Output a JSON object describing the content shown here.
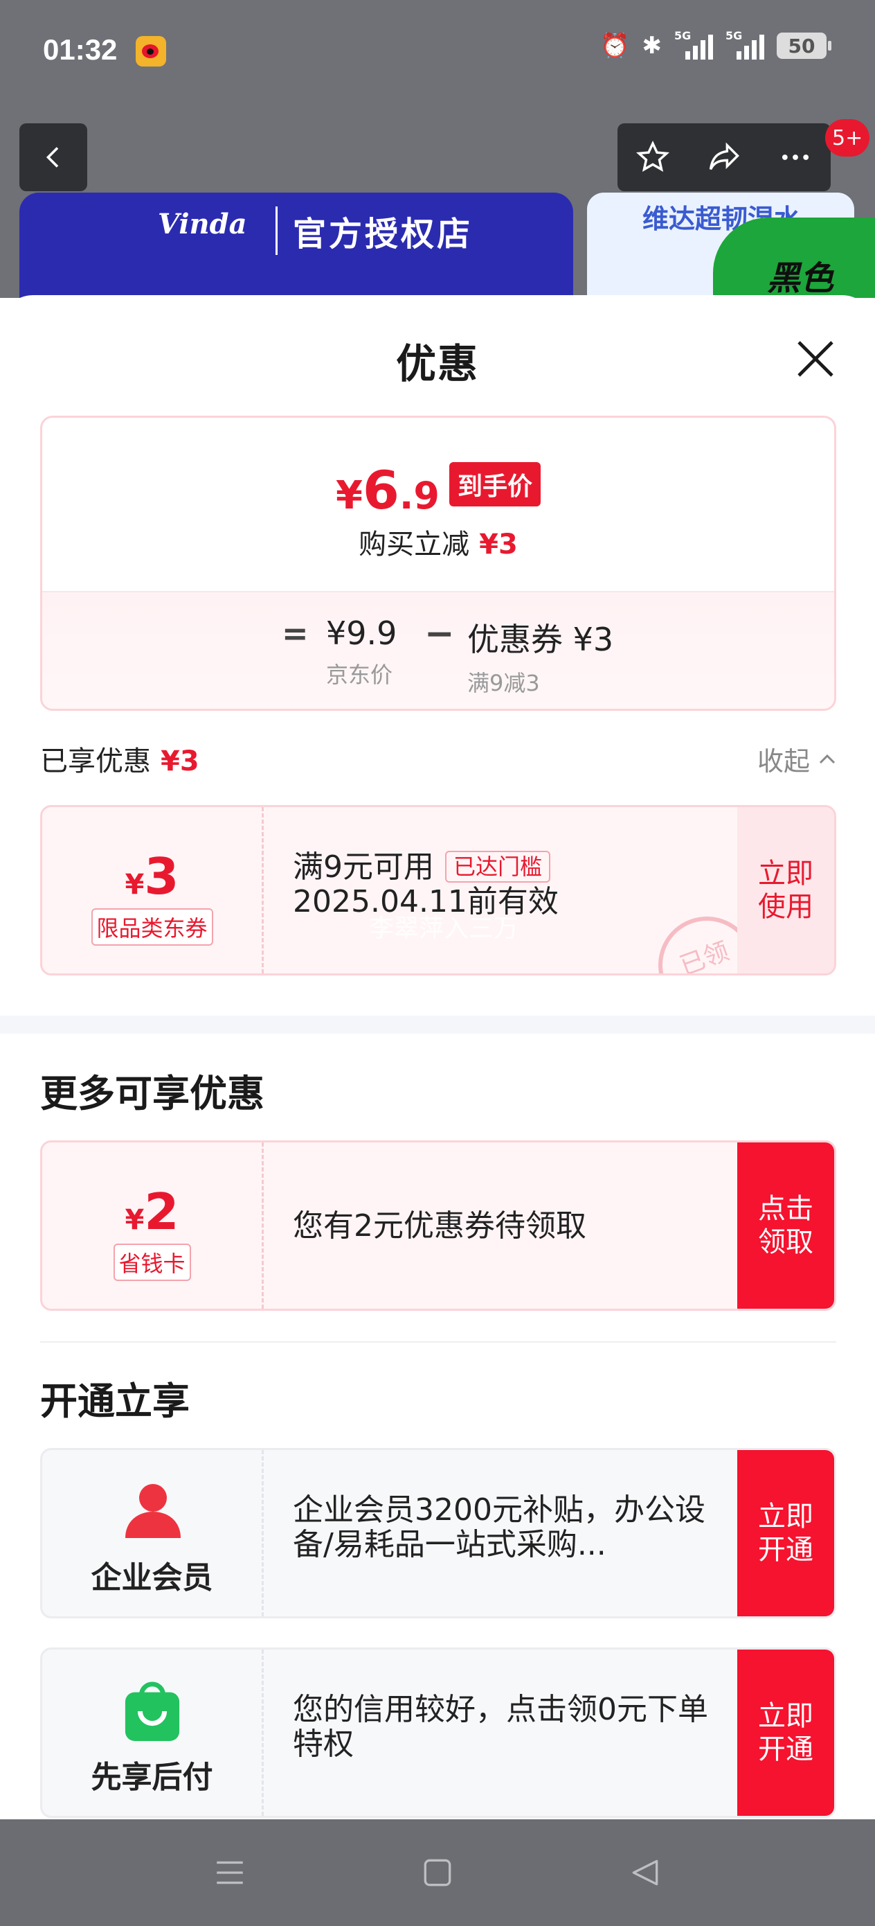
{
  "status_bar": {
    "time": "01:32",
    "signal_label_1": "5G",
    "signal_label_2": "5G",
    "battery": "50"
  },
  "background": {
    "badge": "5+",
    "brand_logo": "Vinda",
    "store_title": "官方授权店",
    "promo_text": "维达超韧湿水",
    "green_promo": "黑色"
  },
  "sheet": {
    "title": "优惠"
  },
  "price_summary": {
    "currency": "¥",
    "final_int": "6",
    "final_dec": ".9",
    "final_tag": "到手价",
    "reduce_label": "购买立减",
    "reduce_value": "¥3",
    "eq": "=",
    "jd_price": "¥9.9",
    "jd_label": "京东价",
    "minus": "−",
    "coupon_price": "优惠券 ¥3",
    "coupon_rule": "满9减3"
  },
  "enjoyed": {
    "label": "已享优惠",
    "value": "¥3",
    "collapse": "收起"
  },
  "coupons": {
    "applied": {
      "currency": "¥",
      "amount": "3",
      "kind": "限品类东券",
      "title": "满9元可用",
      "chip": "已达门槛",
      "validity": "2025.04.11前有效",
      "cta": "立即使用",
      "stamp": "已领",
      "watermark": "李翠萍入三万"
    }
  },
  "more": {
    "title": "更多可享优惠",
    "saver": {
      "currency": "¥",
      "amount": "2",
      "kind": "省钱卡",
      "desc": "您有2元优惠券待领取",
      "cta": "点击领取"
    }
  },
  "open": {
    "title": "开通立享",
    "enterprise": {
      "name": "企业会员",
      "desc": "企业会员3200元补贴，办公设备/易耗品一站式采购...",
      "cta": "立即开通"
    },
    "paylater": {
      "name": "先享后付",
      "desc": "您的信用较好，点击领0元下单特权",
      "cta": "立即开通"
    }
  },
  "colors": {
    "accent": "#e8192f",
    "cta_red": "#f5132f",
    "soft_pink": "#fde7ea",
    "green": "#22c25f"
  }
}
